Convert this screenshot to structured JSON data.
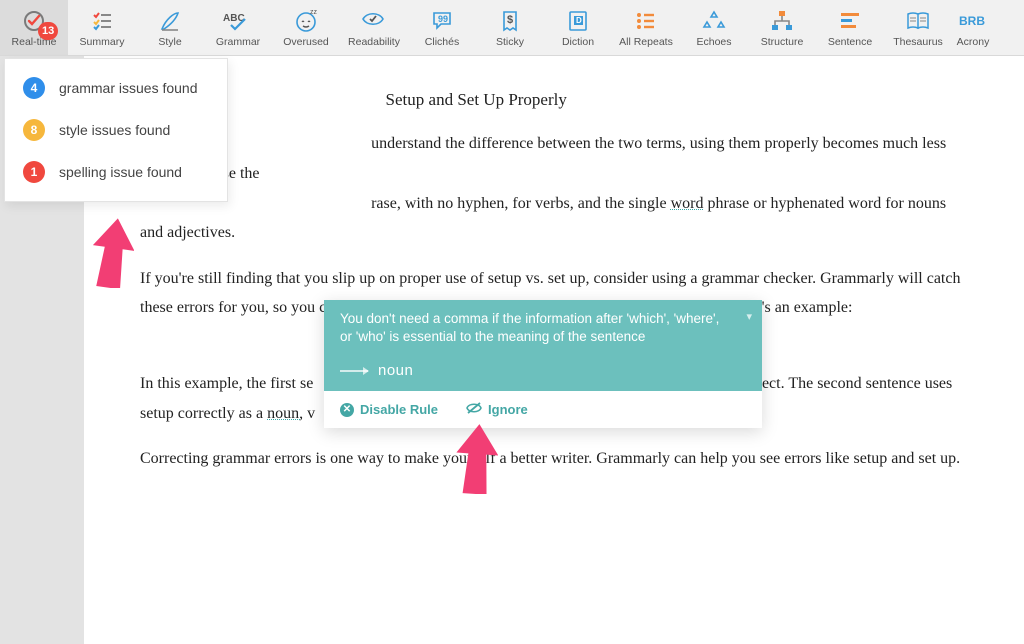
{
  "toolbar": {
    "items": [
      {
        "label": "Real-time",
        "badge": "13"
      },
      {
        "label": "Summary"
      },
      {
        "label": "Style"
      },
      {
        "label": "Grammar"
      },
      {
        "label": "Overused"
      },
      {
        "label": "Readability"
      },
      {
        "label": "Clichés"
      },
      {
        "label": "Sticky"
      },
      {
        "label": "Diction"
      },
      {
        "label": "All Repeats"
      },
      {
        "label": "Echoes"
      },
      {
        "label": "Structure"
      },
      {
        "label": "Sentence"
      },
      {
        "label": "Thesaurus"
      },
      {
        "label": "Acrony"
      }
    ]
  },
  "dropdown": {
    "rows": [
      {
        "count": "4",
        "color": "#2f8eea",
        "text": "grammar issues found"
      },
      {
        "count": "8",
        "color": "#f6b73c",
        "text": "style issues found"
      },
      {
        "count": "1",
        "color": "#f0483e",
        "text": "spelling issue found"
      }
    ]
  },
  "doc": {
    "heading_tail": "Setup and Set Up Properly",
    "p1a": "understand the difference between the two terms, using them properly becomes much less confusing. Use the",
    "p1b": "rase, with no hyphen, for verbs, and the single ",
    "p1_link": "word",
    "p1c": " phrase or hyphenated word for nouns and adjectives.",
    "p2": "If you're still finding that you slip up on proper use of setup vs. set up, consider using a grammar checker. Grammarly will catch these errors for you, so you can correct them before you submit your writing to your reader. Here's an example:",
    "p3a": "In this example, the first se",
    "p3b": "rrect. The second sentence uses setup correctly as a ",
    "p3_link": "noun,",
    "p3c": " v",
    "p4": "Correcting grammar errors is one way to make yourself a better writer. Grammarly can help you see errors like setup and set up."
  },
  "tip": {
    "message": "You don't need a comma if the information after 'which', 'where', or 'who' is essential to the meaning of the sentence",
    "suggestion": "noun",
    "actions": {
      "disable": "Disable Rule",
      "ignore": "Ignore"
    }
  }
}
